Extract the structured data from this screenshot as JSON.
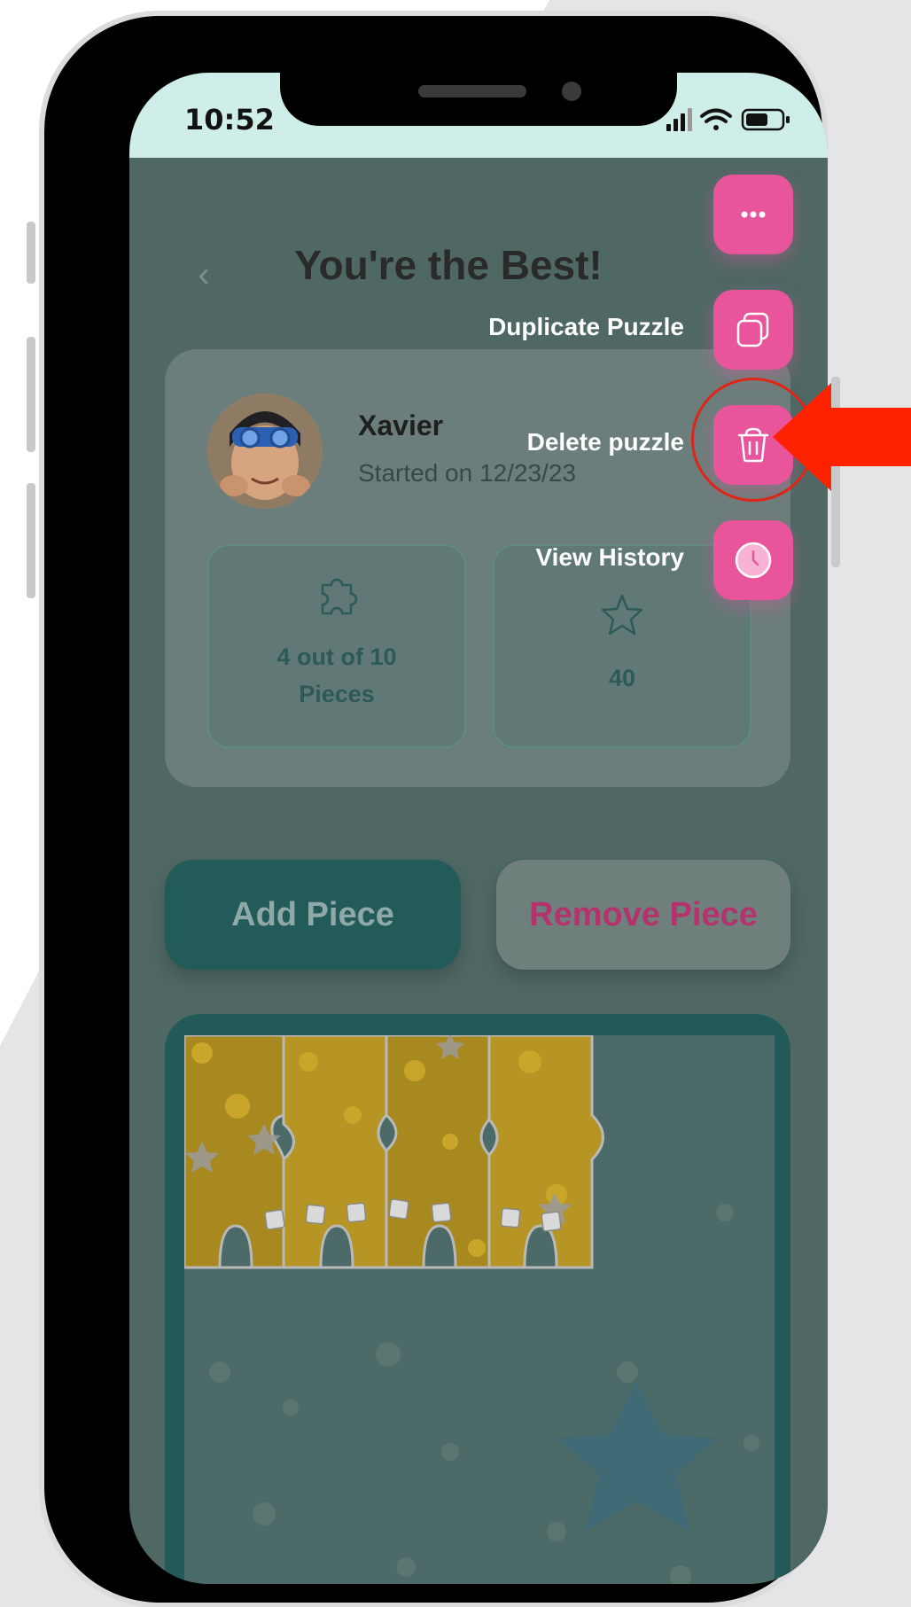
{
  "status_bar": {
    "time": "10:52"
  },
  "header": {
    "title": "You're the Best!"
  },
  "profile": {
    "name": "Xavier",
    "started": "Started on 12/23/23"
  },
  "stats": {
    "pieces_line1": "4 out of 10",
    "pieces_line2": "Pieces",
    "stars_value": "40"
  },
  "buttons": {
    "add_piece": "Add Piece",
    "remove_piece": "Remove Piece"
  },
  "menu": {
    "duplicate_label": "Duplicate Puzzle",
    "delete_label": "Delete puzzle",
    "history_label": "View History"
  },
  "puzzle": {
    "pieces_completed": 4,
    "pieces_total": 10
  },
  "colors": {
    "accent_pink": "#e9559c",
    "teal": "#235b5a",
    "annotation_red": "#e02418"
  }
}
